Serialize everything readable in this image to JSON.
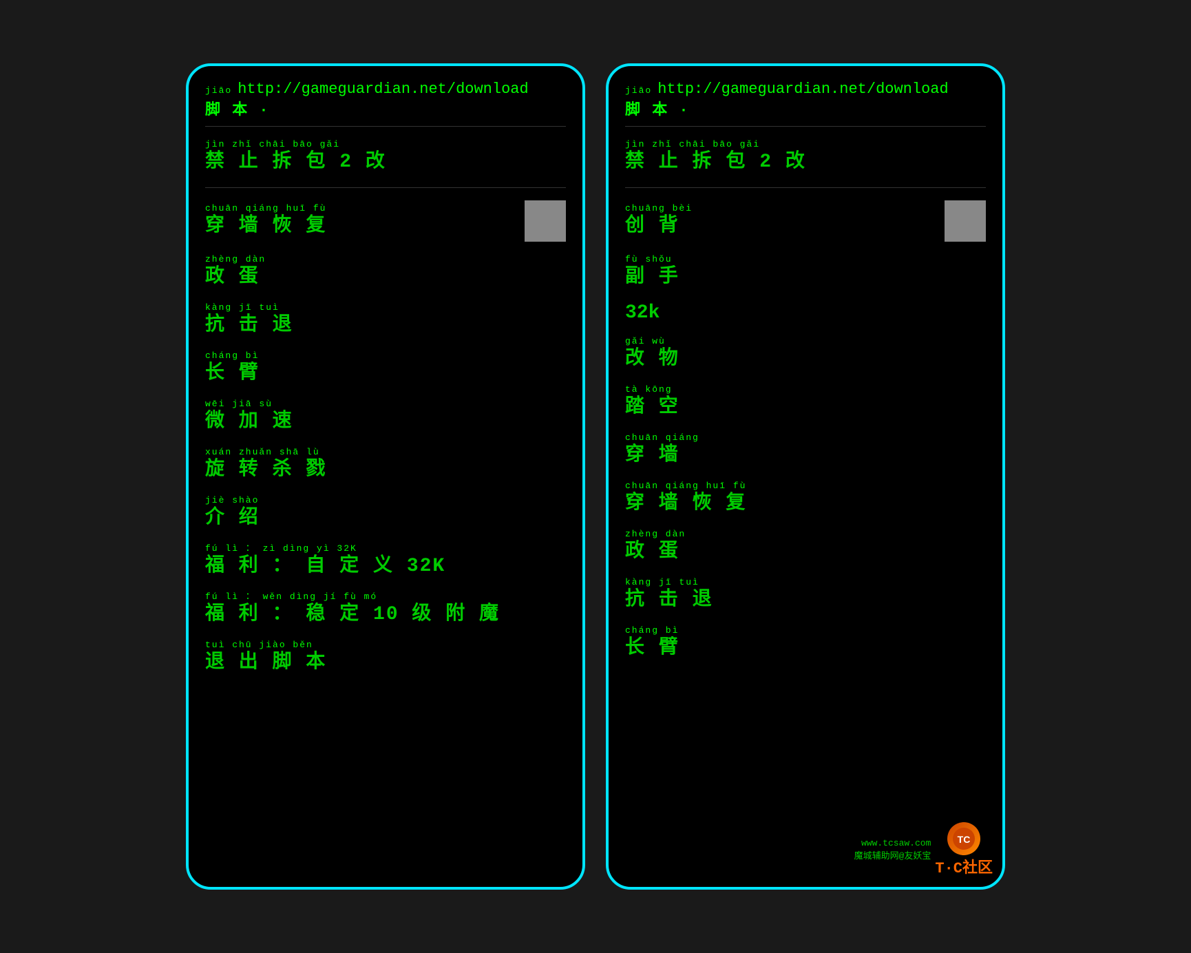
{
  "background_color": "#1a1a1a",
  "accent_color": "#00e5ff",
  "text_color_green": "#00ff00",
  "text_color_dark_green": "#00cc00",
  "phone1": {
    "header": {
      "pinyin": "jiāo",
      "url": "http://gameguardian.net/download",
      "line2_pinyin": "脚 本 ·",
      "divider": true,
      "title_pinyin": "jìn zhǐ chāi bāo gǎi",
      "title": "禁 止 拆 包 2 改"
    },
    "items": [
      {
        "pinyin": "chuān qiáng huī fù",
        "text": "穿 墙 恢 复",
        "has_button": true,
        "button_color": "#888888"
      },
      {
        "pinyin": "zhèng dàn",
        "text": "政 蛋",
        "has_button": false
      },
      {
        "pinyin": "kàng jī tuì",
        "text": "抗 击 退",
        "has_button": false
      },
      {
        "pinyin": "cháng bì",
        "text": "长 臂",
        "has_button": false
      },
      {
        "pinyin": "wēi jiā sù",
        "text": "微 加 速",
        "has_button": false
      },
      {
        "pinyin": "xuán zhuǎn shā lù",
        "text": "旋 转 杀 戮",
        "has_button": false
      },
      {
        "pinyin": "jiè shào",
        "text": "介 绍",
        "has_button": false
      },
      {
        "pinyin": "fú lì ： zì dìng yì 32K",
        "text": "福 利 ：  自 定 义 32K",
        "has_button": false
      },
      {
        "pinyin": "fú lì ： wěn dìng  jí fù mó",
        "text": "福 利 ： 稳 定 10 级 附 魔",
        "has_button": false
      },
      {
        "pinyin": "tuì chū jiào běn",
        "text": "退 出 脚 本",
        "has_button": false
      }
    ]
  },
  "phone2": {
    "header": {
      "pinyin": "jiāo",
      "url": "http://gameguardian.net/download",
      "line2_pinyin": "脚 本 ·",
      "divider": true,
      "title_pinyin": "jìn zhǐ chāi bāo gǎi",
      "title": "禁 止 拆 包 2 改"
    },
    "items": [
      {
        "pinyin": "chuāng bèi",
        "text": "创 背",
        "has_button": true,
        "button_color": "#888888"
      },
      {
        "pinyin": "fù shǒu",
        "text": "副 手",
        "has_button": false
      },
      {
        "size_label": "32k",
        "is_size": true
      },
      {
        "pinyin": "gǎi wù",
        "text": "改 物",
        "has_button": false
      },
      {
        "pinyin": "tà kōng",
        "text": "踏 空",
        "has_button": false
      },
      {
        "pinyin": "chuān qiáng",
        "text": "穿 墙",
        "has_button": false
      },
      {
        "pinyin": "chuān qiáng huī fù",
        "text": "穿 墙 恢 复",
        "has_button": false
      },
      {
        "pinyin": "zhèng dàn",
        "text": "政 蛋",
        "has_button": false
      },
      {
        "pinyin": "kàng jī tuì",
        "text": "抗 击 退",
        "has_button": false
      },
      {
        "pinyin": "cháng bì",
        "text": "长 臂",
        "has_button": false
      }
    ]
  },
  "watermark": {
    "site": "www.tcsaw.com",
    "label": "魔城辅助网@友妖宝",
    "tc_label": "T·C社区"
  }
}
